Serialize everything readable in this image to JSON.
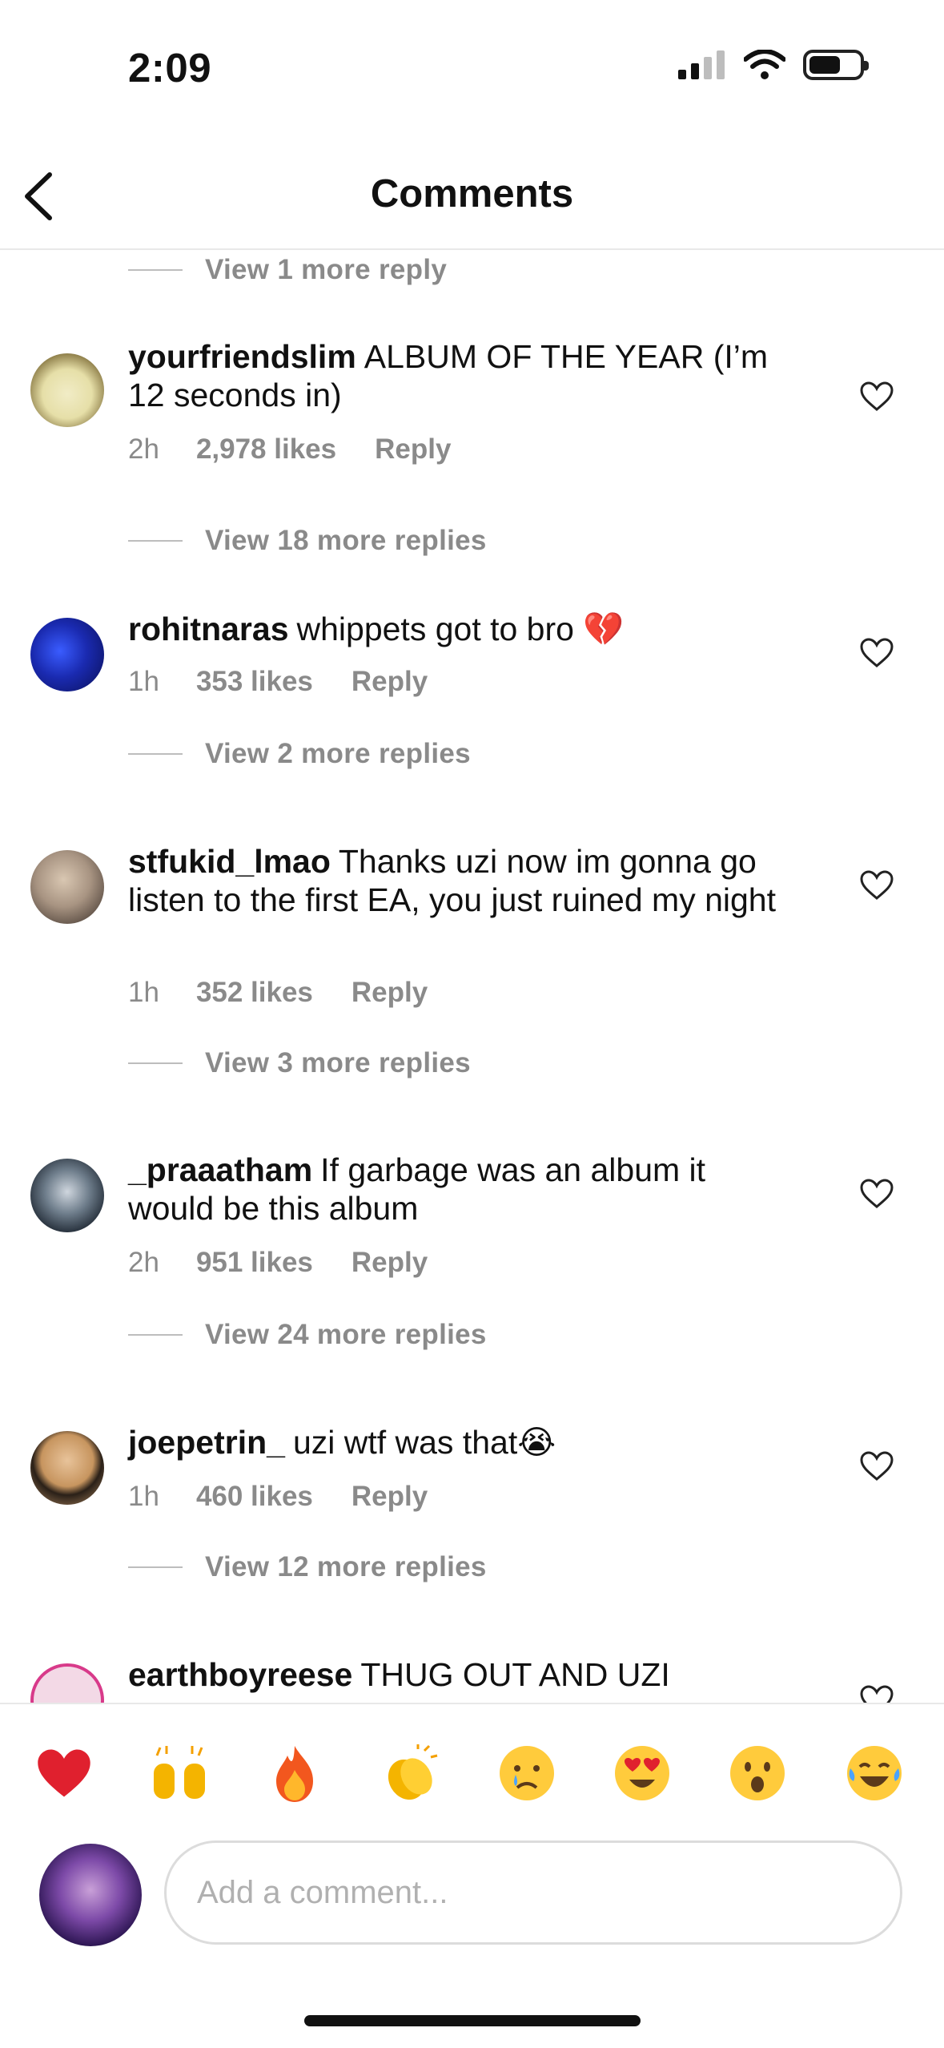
{
  "status": {
    "time": "2:09"
  },
  "header": {
    "title": "Comments"
  },
  "view_more_top": "View 1 more reply",
  "comments": [
    {
      "user": "yourfriendslim",
      "text": "ALBUM OF THE YEAR (I’m 12 seconds in)",
      "time": "2h",
      "likes": "2,978 likes",
      "reply": "Reply",
      "view_more": "View 18 more replies"
    },
    {
      "user": "rohitnaras",
      "text": "whippets got to bro 💔",
      "time": "1h",
      "likes": "353 likes",
      "reply": "Reply",
      "view_more": "View 2 more replies"
    },
    {
      "user": "stfukid_lmao",
      "text": "Thanks uzi now im gonna go listen to the first EA, you just ruined my night",
      "time": "1h",
      "likes": "352 likes",
      "reply": "Reply",
      "view_more": "View 3 more replies"
    },
    {
      "user": "_praaatham",
      "text": "If garbage was an album it would be this album",
      "time": "2h",
      "likes": "951 likes",
      "reply": "Reply",
      "view_more": "View 24 more replies"
    },
    {
      "user": "joepetrin_",
      "text": "uzi wtf was that😭",
      "time": "1h",
      "likes": "460 likes",
      "reply": "Reply",
      "view_more": "View 12 more replies"
    },
    {
      "user": "earthboyreese",
      "text": "THUG OUT AND UZI"
    }
  ],
  "emoji_bar": [
    "❤️",
    "🙌",
    "🔥",
    "👏",
    "😢",
    "😍",
    "😮",
    "😂"
  ],
  "composer": {
    "placeholder": "Add a comment..."
  },
  "colors": {
    "secondary_text": "#8a8a8a",
    "divider": "#e8e8e8"
  }
}
